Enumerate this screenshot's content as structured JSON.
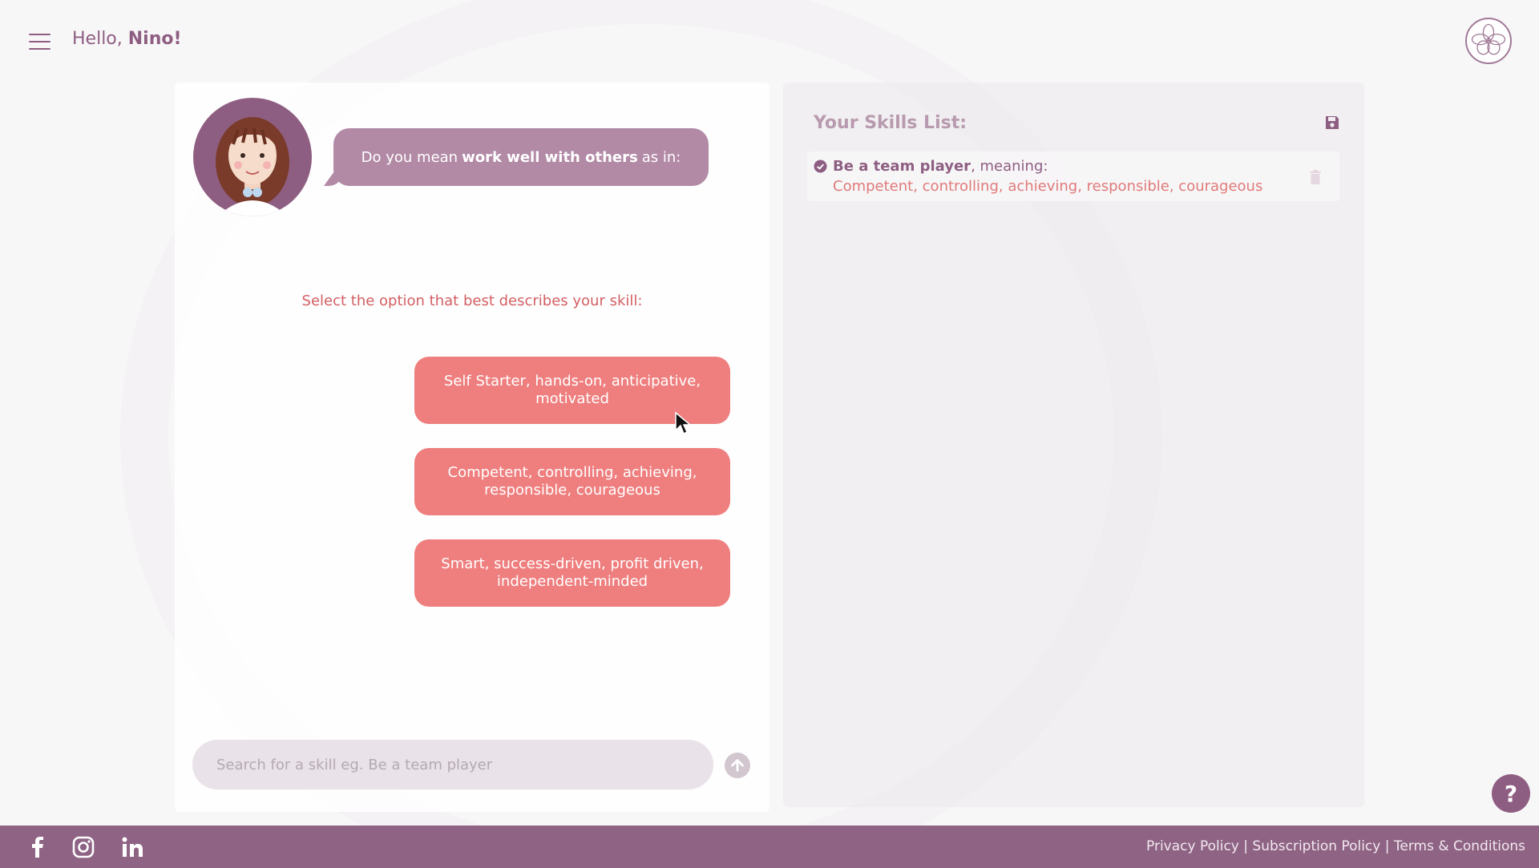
{
  "header": {
    "greeting_prefix": "Hello,",
    "user_name": "Nino!"
  },
  "chat": {
    "bot_message_prefix": "Do you mean",
    "bot_message_bold": "work well with others",
    "bot_message_suffix": "as in:",
    "instruction": "Select the option that best describes your skill:",
    "options": [
      "Self Starter, hands-on, anticipative, motivated",
      "Competent, controlling, achieving, responsible, courageous",
      "Smart, success-driven, profit driven, independent-minded"
    ],
    "search": {
      "placeholder": "Search for a skill eg. Be a team player",
      "value": ""
    }
  },
  "skills": {
    "title": "Your Skills List:",
    "items": [
      {
        "name": "Be a team player",
        "name_suffix": ", meaning:",
        "meaning": "Competent, controlling, achieving, responsible, courageous"
      }
    ]
  },
  "help": {
    "label": "?"
  },
  "footer": {
    "links": [
      "Privacy Policy",
      "Subscription Policy",
      "Terms & Conditions"
    ],
    "separator": " | ",
    "social_icons": [
      "facebook-icon",
      "instagram-icon",
      "linkedin-icon"
    ]
  },
  "colors": {
    "brand": "#8e5e82",
    "option_bg": "#ef7e7e",
    "bubble_bg": "#b28aa6",
    "accent_text": "#d35f64",
    "footer_bg": "#8e6384"
  }
}
